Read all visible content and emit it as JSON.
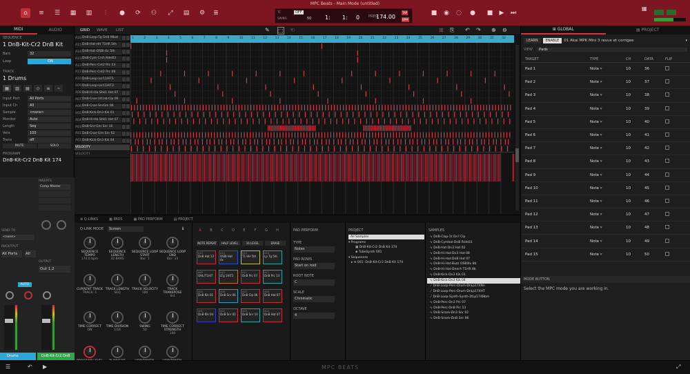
{
  "title": "MPC Beats - Main Mode (untitled)",
  "transport": {
    "bar": "1:",
    "beat": "1:",
    "tick": "0",
    "tempo": "174.00",
    "tap": "TAP",
    "bpm": "BPM",
    "tc": "TC",
    "off": "OFF",
    "swing_lbl": "SWING",
    "swing": "50",
    "ng_lbl": "PREG"
  },
  "left": {
    "tab_midi": "MIDI",
    "tab_audio": "AUDIO",
    "seq_hdr": "SEQUENCE",
    "seq_name": "1 DnB-Kit-Cr2 DnB Kit",
    "bars_k": "Bars",
    "bars_v": "32",
    "loop_k": "Loop",
    "loop_v": "ON",
    "track_hdr": "TRACK",
    "track_name": "1 Drums",
    "params": [
      {
        "k": "Input Port",
        "v": "All Ports"
      },
      {
        "k": "Input Ch",
        "v": "All"
      },
      {
        "k": "Sample",
        "v": "<none>"
      },
      {
        "k": "Monitor",
        "v": "Auto"
      },
      {
        "k": "Length",
        "v": "Seq"
      },
      {
        "k": "Velo",
        "v": "100"
      },
      {
        "k": "Trans",
        "v": "off"
      }
    ],
    "mute": "MUTE",
    "solo": "SOLO",
    "prog_hdr": "PROGRAM",
    "prog_name": "DnB-Kit-Cr2 DnB Kit 174",
    "inserts": "INSERTS",
    "insert1": "Comp Master",
    "send_to": "SEND TO",
    "send_val": "<none>",
    "in_out": "IN/OUTPUT",
    "all_ports": "All Ports",
    "all": "All",
    "output": "OUTPUT",
    "out12": "Out 1,2",
    "auto": "AUTO",
    "ch1": "Drums",
    "ch2": "DnB-Kit-Cr2 DnB"
  },
  "grid": {
    "tabs": [
      "GRID",
      "WAVE",
      "LIST"
    ],
    "tracks": [
      {
        "n": "A16",
        "name": "DnB-Loop-Tg DnB Mbat"
      },
      {
        "n": "A15",
        "name": "DnB-Hat-HH T1HR 5th"
      },
      {
        "n": "A14",
        "name": "DnB-Hat-OSBI-4x 5th"
      },
      {
        "n": "A13",
        "name": "DnB-Cym Crsh RdeB3"
      },
      {
        "n": "A12",
        "name": "DnB-Perc-Cnt2 Prc 13"
      },
      {
        "n": "A11",
        "name": "DnB-Perc-Cnt2 Prc 08"
      },
      {
        "n": "A10",
        "name": "DnB-Loop-Lsr11HiT1"
      },
      {
        "n": "A09",
        "name": "DnB-Loop-Lsr11HiT2"
      },
      {
        "n": "A08",
        "name": "DnB-Hi-Ha Shk1 Hat 07"
      },
      {
        "n": "A07",
        "name": "DnB-Cnar-1tCnb-Clp 06"
      },
      {
        "n": "A06",
        "name": "DnB-Cnar-SnrGm 06"
      },
      {
        "n": "A05",
        "name": "DnB-Kick-Dn3 Kik 01"
      },
      {
        "n": "A04",
        "name": "DnB-Hi-Ha Shk1 Hat 07"
      },
      {
        "n": "A03",
        "name": "DnB-Snr-Grn Snr 10"
      },
      {
        "n": "A02",
        "name": "DnB-Cnar-Grn Snr 02"
      },
      {
        "n": "A01",
        "name": "DnB-Kick-Dn3 Kik 04"
      }
    ],
    "velocity": "VELOCITY",
    "velocity2": "VELOCITY",
    "ruler": [
      "1",
      "2",
      "3",
      "4",
      "5",
      "6",
      "7",
      "8",
      "9",
      "10",
      "11",
      "12",
      "13",
      "14",
      "15",
      "16",
      "17",
      "18",
      "19",
      "20",
      "21",
      "22",
      "23",
      "24",
      "25",
      "26",
      "27",
      "28",
      "29",
      "30",
      "31",
      "32"
    ]
  },
  "bottom": {
    "tabs": [
      "Q-LINKS",
      "PADS",
      "PAD PERFORM",
      "PROJECT"
    ],
    "qlink_mode_k": "Q-LINK MODE",
    "qlink_mode_v": "Screen",
    "knobs": [
      {
        "t": "SEQUENCE TEMPO",
        "v": "174.0 bpm"
      },
      {
        "t": "SEQUENCE LENGTH",
        "v": "32 BARS"
      },
      {
        "t": "SEQUENCE LOOP START",
        "v": "Bar: 1"
      },
      {
        "t": "SEQUENCE LOOP END",
        "v": "Bar: 33"
      },
      {
        "t": "CURRENT TRACK",
        "v": "TRACK: 1"
      },
      {
        "t": "TRACK LENGTH",
        "v": "SEQ"
      },
      {
        "t": "TRACK VELOCITY",
        "v": "100"
      },
      {
        "t": "TRACK TRANSPOSE",
        "v": "0st"
      },
      {
        "t": "TIME CORRECT",
        "v": "ON"
      },
      {
        "t": "TIME DIVISION",
        "v": "1/16"
      },
      {
        "t": "SWING",
        "v": "50"
      },
      {
        "t": "TIME CORRECT STRENGTH",
        "v": "100"
      },
      {
        "t": "PROGRAM LEVEL",
        "v": "-0.0dB"
      },
      {
        "t": "PLAYHEAD",
        "v": "0%"
      },
      {
        "t": "HORIZONTAL SCROLL",
        "v": "0%"
      },
      {
        "t": "HORIZONTAL ZOOM",
        "v": "0%"
      }
    ],
    "banks": [
      "A",
      "B",
      "C",
      "D",
      "E",
      "F",
      "G",
      "H"
    ],
    "pad_btns": [
      "NOTE REPEAT",
      "HALF LEVEL",
      "16 LEVEL",
      "ERASE"
    ],
    "pads": [
      {
        "n": "A13",
        "s": "DnB Hat 13"
      },
      {
        "n": "A14",
        "s": "OSBI Hat 4x"
      },
      {
        "n": "A15",
        "s": "T1 HH 5th"
      },
      {
        "n": "A16",
        "s": "Lp Tg 5th"
      },
      {
        "n": "A09",
        "s": "OHL/T1HiT"
      },
      {
        "n": "A10",
        "s": "LTg 1HiT2"
      },
      {
        "n": "A11",
        "s": "DnB Prc 07"
      },
      {
        "n": "A12",
        "s": "DnB Prc 13"
      },
      {
        "n": "A05",
        "s": "DnB Kik 01"
      },
      {
        "n": "A06",
        "s": "DnB Snr 06"
      },
      {
        "n": "A07",
        "s": "DnB Clp 06"
      },
      {
        "n": "A08",
        "s": "DnB Hat 07"
      },
      {
        "n": "A01",
        "s": "DnB Kik 04"
      },
      {
        "n": "A02",
        "s": "DnB Snr 02"
      },
      {
        "n": "A03",
        "s": "DnB Snr 10"
      },
      {
        "n": "A04",
        "s": "DnB Hat 07"
      }
    ],
    "perform": {
      "hdr": "PAD PERFORM",
      "type_k": "TYPE",
      "type_v": "Notes",
      "rows_k": "PAD ROWS",
      "rows_v": "Start on root",
      "root_k": "ROOT NOTE",
      "root_v": "C",
      "scale_k": "SCALE",
      "scale_v": "Chromatic",
      "oct_k": "OCTAVE",
      "oct_v": "4"
    },
    "project": {
      "hdr": "PROJECT",
      "all": "All Samples",
      "programs": "Programs",
      "p1": "DnB-Kit-Cr2 DnB Kit 174",
      "p2": "TubeSynth 001",
      "sequences": "Sequences",
      "s1": "001: DnB-Kit-Cr2 DnB Kit 174"
    },
    "samples": {
      "hdr": "SAMPLES",
      "items": [
        "DnB-Clap-1t Dn? Clp",
        "DnB-Cymbal-DnB Ride03",
        "DnB-Hat-Dn3 Hat 02",
        "DnB-Hi-Hat-Dn3 Hat 08",
        "DnB-Hi-Hat-DnB Hat 07",
        "DnB-Hi-Hat-Buzz OSBI4x 8b",
        "DnB-Hi-Hat-DnerA T1HR 8b",
        "DnB-Kick-Dn3 Kik 01",
        "DnB-Kick-Dn3 Kik 04",
        "DnB-Loop-Perc-Drum-DnLp174Nn",
        "DnB-Loop-Perc-Drum-DnLp174HT",
        "DnB-Loop-Synth-Synth-2tLp174Bbm",
        "DnB-Perc-Dn3 Prc 07",
        "DnB-Perc-DnB Prc 13",
        "DnB-Snare-Dn3 Snr 02",
        "DnB-Snare-DnB Snr 06"
      ]
    }
  },
  "right": {
    "tab_global": "GLOBAL",
    "tab_project": "PROJECT",
    "learn": "LEARN",
    "enable": "ENABLE",
    "device": "01 Akai MPK Mini 3 revue et corrigee",
    "view_k": "VIEW",
    "view_v": "Pads",
    "cols": [
      "TARGET",
      "TYPE",
      "CH",
      "DATA",
      "FLIP"
    ],
    "rows": [
      {
        "t": "Pad 1",
        "ty": "Note",
        "ch": "10",
        "d": "36"
      },
      {
        "t": "Pad 2",
        "ty": "Note",
        "ch": "10",
        "d": "37"
      },
      {
        "t": "Pad 3",
        "ty": "Note",
        "ch": "10",
        "d": "38"
      },
      {
        "t": "Pad 4",
        "ty": "Note",
        "ch": "10",
        "d": "39"
      },
      {
        "t": "Pad 5",
        "ty": "Note",
        "ch": "10",
        "d": "40"
      },
      {
        "t": "Pad 6",
        "ty": "Note",
        "ch": "10",
        "d": "41"
      },
      {
        "t": "Pad 7",
        "ty": "Note",
        "ch": "10",
        "d": "42"
      },
      {
        "t": "Pad 8",
        "ty": "Note",
        "ch": "10",
        "d": "43"
      },
      {
        "t": "Pad 9",
        "ty": "Note",
        "ch": "10",
        "d": "44"
      },
      {
        "t": "Pad 10",
        "ty": "Note",
        "ch": "10",
        "d": "45"
      },
      {
        "t": "Pad 11",
        "ty": "Note",
        "ch": "10",
        "d": "46"
      },
      {
        "t": "Pad 12",
        "ty": "Note",
        "ch": "10",
        "d": "47"
      },
      {
        "t": "Pad 13",
        "ty": "Note",
        "ch": "10",
        "d": "48"
      },
      {
        "t": "Pad 14",
        "ty": "Note",
        "ch": "10",
        "d": "49"
      },
      {
        "t": "Pad 15",
        "ty": "Note",
        "ch": "10",
        "d": "50"
      }
    ],
    "mode_hdr": "MODE BUTTON",
    "mode_desc": "Select the MPC mode you are working in."
  },
  "status": {
    "logo": "MPC BEATS"
  }
}
